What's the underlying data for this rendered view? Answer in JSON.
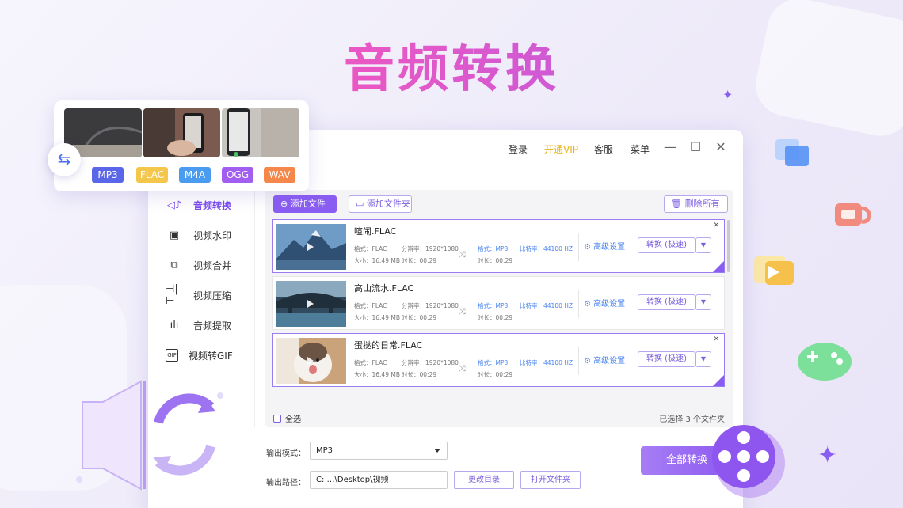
{
  "hero_title": "音频转换",
  "format_card": {
    "swap_icon": "⇆",
    "formats": [
      {
        "label": "MP3",
        "color": "#5a66e8"
      },
      {
        "label": "FLAC",
        "color": "#f4c64a"
      },
      {
        "label": "M4A",
        "color": "#4a9cf0"
      },
      {
        "label": "OGG",
        "color": "#a15ef0"
      },
      {
        "label": "WAV",
        "color": "#f5874a"
      }
    ]
  },
  "topbar": {
    "login": "登录",
    "vip": "开通VIP",
    "service": "客服",
    "menu": "菜单"
  },
  "sidebar": {
    "items": [
      {
        "label": "音频转换",
        "icon": "speaker-icon",
        "active": true
      },
      {
        "label": "视频水印",
        "icon": "watermark-icon"
      },
      {
        "label": "视频合并",
        "icon": "merge-icon"
      },
      {
        "label": "视频压缩",
        "icon": "compress-icon"
      },
      {
        "label": "音频提取",
        "icon": "waveform-icon"
      },
      {
        "label": "视频转GIF",
        "icon": "gif-icon"
      }
    ]
  },
  "toolbar": {
    "add_file": "添加文件",
    "add_folder": "添加文件夹",
    "delete_all": "删除所有"
  },
  "files": [
    {
      "name": "喧闹.FLAC",
      "format_label": "格式：",
      "format": "FLAC",
      "res_label": "分辨率：",
      "resolution": "1920*1080",
      "size_label": "大小：",
      "size": "16.49 MB",
      "dur_label": "时长：",
      "duration": "00:29",
      "out_format": "MP3",
      "bitrate_label": "比特率：",
      "bitrate": "44100 HZ",
      "out_duration": "00:29",
      "advanced": "高级设置",
      "convert": "转换 (极速)"
    },
    {
      "name": "高山流水.FLAC",
      "format_label": "格式：",
      "format": "FLAC",
      "res_label": "分辨率：",
      "resolution": "1920*1080",
      "size_label": "大小：",
      "size": "16.49 MB",
      "dur_label": "时长：",
      "duration": "00:29",
      "out_format": "MP3",
      "bitrate_label": "比特率：",
      "bitrate": "44100 HZ",
      "out_duration": "00:29",
      "advanced": "高级设置",
      "convert": "转换 (极速)"
    },
    {
      "name": "蛋挞的日常.FLAC",
      "format_label": "格式：",
      "format": "FLAC",
      "res_label": "分辨率：",
      "resolution": "1920*1080",
      "size_label": "大小：",
      "size": "16.49 MB",
      "dur_label": "时长：",
      "duration": "00:29",
      "out_format": "MP3",
      "bitrate_label": "比特率：",
      "bitrate": "44100 HZ",
      "out_duration": "00:29",
      "advanced": "高级设置",
      "convert": "转换 (极速)"
    }
  ],
  "footer": {
    "select_all": "全选",
    "selected_count": "已选择 3 个文件夹",
    "output_mode_label": "输出模式：",
    "output_mode": "MP3",
    "output_path_label": "输出路径：",
    "output_path": "C: …\\Desktop\\视频",
    "change_dir": "更改目录",
    "open_folder": "打开文件夹",
    "convert_all": "全部转换"
  }
}
